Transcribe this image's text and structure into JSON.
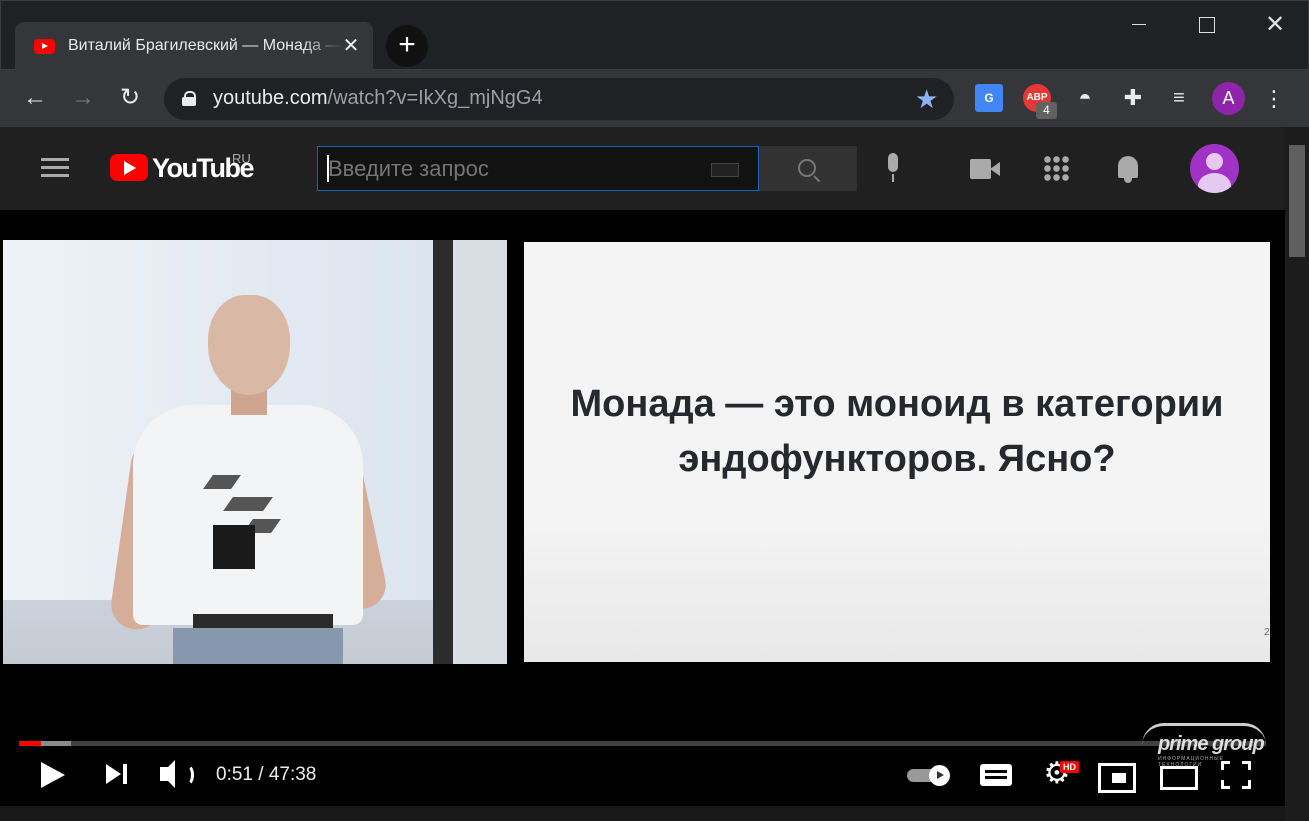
{
  "browser": {
    "tab": {
      "title": "Виталий Брагилевский — Монада — это моноид в категории эндофункторов",
      "close_glyph": "✕"
    },
    "new_tab_glyph": "+",
    "window": {
      "close_glyph": "✕"
    },
    "nav": {
      "back_glyph": "←",
      "forward_glyph": "→",
      "reload_glyph": "↻"
    },
    "address": {
      "host": "youtube.com",
      "path": "/watch?v=IkXg_mjNgG4"
    },
    "bookmark_glyph": "★",
    "extensions": {
      "translate_label": "G",
      "abp_label": "ABP",
      "abp_badge": "4",
      "spy_glyph": "◓",
      "puzzle_glyph": "✚",
      "media_glyph": "≡"
    },
    "profile_initial": "A",
    "menu_glyph": "⋮"
  },
  "youtube": {
    "wordmark": "YouTube",
    "region": "RU",
    "search": {
      "placeholder": "Введите запрос"
    }
  },
  "video": {
    "slide_text": "Монада — это моноид в категории эндофункторов. Ясно?",
    "slide_mark": "2",
    "watermark": {
      "name": "prime group",
      "tagline": "ИНФОРМАЦИОННЫЕ ТЕХНОЛОГИИ"
    },
    "progress": {
      "played_fraction": 0.018,
      "buffered_fraction": 0.042
    },
    "time": "0:51 / 47:38",
    "settings_glyph": "⚙",
    "hd_badge": "HD"
  },
  "colors": {
    "brand_red": "#ff0000",
    "search_focus": "#1c62b9",
    "avatar": "#a033c6",
    "profile": "#8e24aa"
  }
}
